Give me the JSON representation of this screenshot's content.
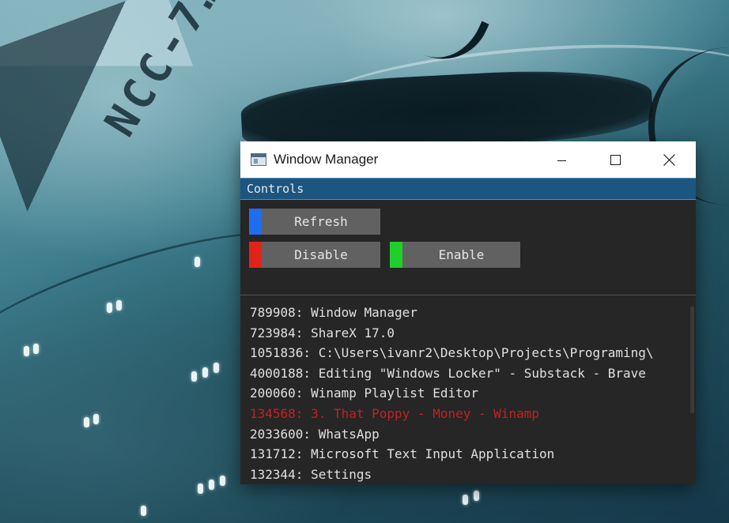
{
  "window": {
    "title": "Window Manager",
    "icon": "app-window-icon",
    "controls": {
      "minimize": "minimize-icon",
      "maximize": "maximize-icon",
      "close": "×"
    }
  },
  "controls_section": {
    "header": "Controls",
    "buttons": [
      {
        "label": "Refresh",
        "accent": "#1f6ef0"
      },
      {
        "label": "Disable",
        "accent": "#e2231a"
      },
      {
        "label": "Enable",
        "accent": "#1fcf2a"
      }
    ]
  },
  "window_list": {
    "highlight_color": "#c62020",
    "items": [
      "789908: Window Manager",
      "723984: ShareX 17.0",
      "1051836: C:\\Users\\ivanr2\\Desktop\\Projects\\Programing\\",
      "4000188: Editing \"Windows Locker\" - Substack - Brave",
      "200060: Winamp Playlist Editor",
      "134568: 3. That Poppy - Money - Winamp",
      "2033600: WhatsApp",
      "131712: Microsoft Text Input Application",
      "132344: Settings"
    ]
  },
  "colors": {
    "window_bg": "#262626",
    "header_bg": "#1d5581",
    "button_bg": "#616161",
    "text": "#e0e0e0"
  }
}
